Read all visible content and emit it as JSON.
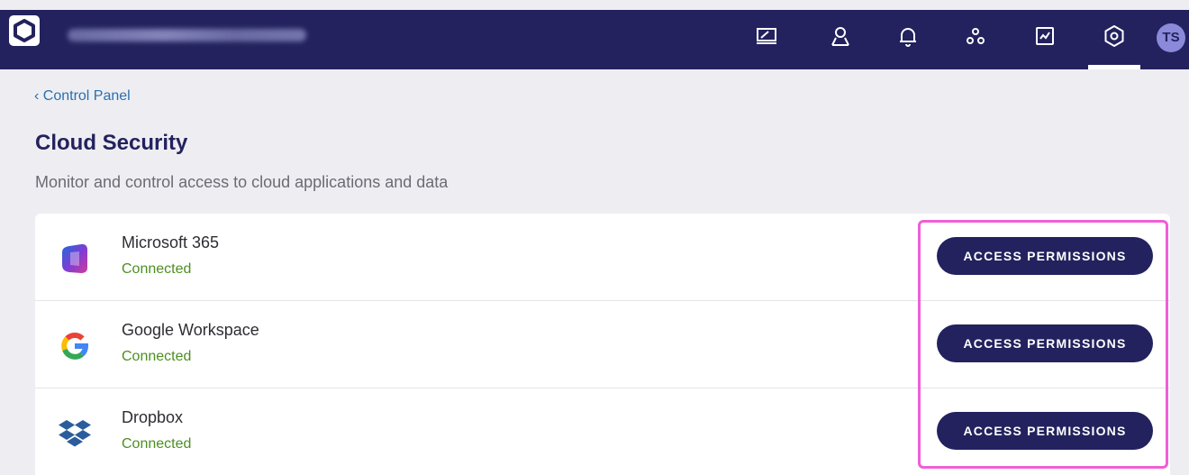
{
  "header": {
    "org_name_blurred": "",
    "nav_icons": [
      "devices-icon",
      "users-icon",
      "alerts-icon",
      "integrations-icon",
      "reports-icon",
      "settings-icon"
    ],
    "active_nav": "settings-icon",
    "avatar_initials": "TS",
    "bar_color": "#23225e"
  },
  "breadcrumb": {
    "label": "‹ Control Panel"
  },
  "page": {
    "title": "Cloud Security",
    "subtitle": "Monitor and control access to cloud applications and data"
  },
  "apps": [
    {
      "name": "Microsoft 365",
      "status": "Connected",
      "button": "ACCESS PERMISSIONS",
      "icon": "microsoft-365-icon"
    },
    {
      "name": "Google Workspace",
      "status": "Connected",
      "button": "ACCESS PERMISSIONS",
      "icon": "google-icon"
    },
    {
      "name": "Dropbox",
      "status": "Connected",
      "button": "ACCESS PERMISSIONS",
      "icon": "dropbox-icon"
    }
  ],
  "colors": {
    "accent": "#23225e",
    "status_connected": "#4c8f20",
    "link": "#2b6fb0",
    "highlight": "#ef5fd7"
  }
}
